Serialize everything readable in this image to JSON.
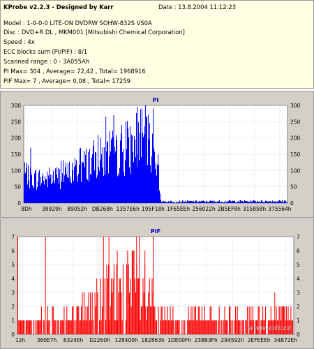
{
  "header": {
    "title": "KProbe v2.2.3 - Designed by Karr",
    "date_label": "Date : 13.8.2004 11:12:23",
    "lines": [
      "Model : 1-0-0-0 LITE-ON DVDRW SOHW-832S  VS0A",
      "Disc : DVD+R DL , MKM001 [Mitsubishi Chemical Corporation]",
      "Speed : 4x",
      "ECC blocks sum (PI/PIF) : 8/1",
      "Scanned range : 0 - 3A055Ah",
      "PI Max= 304 , Average= 72,42 , Total= 1968916",
      "PIF Max= 7 , Average= 0,08 , Total= 17259"
    ]
  },
  "watermark": "www.cdr.cz",
  "colors": {
    "pi": "#0000ff",
    "pif": "#ff0000",
    "plot_bg": "#ffffff",
    "panel_bg": "#d4d0c8",
    "info_bg": "#ffffe3",
    "title_color": "#0000b0"
  },
  "chart_data": [
    {
      "type": "bar",
      "title": "PI",
      "yticks": [
        0,
        50,
        100,
        150,
        200,
        250,
        300
      ],
      "ylim": [
        0,
        300
      ],
      "xticks": [
        "8Dh",
        "38929h",
        "89052h",
        "DB268h",
        "1357E6h",
        "195F18h",
        "1F65EEh",
        "256022h",
        "2B5EF8h",
        "315858h",
        "375564h"
      ],
      "grid": true,
      "envelope_x": [
        0,
        0.05,
        0.1,
        0.15,
        0.2,
        0.25,
        0.3,
        0.35,
        0.4,
        0.45,
        0.5,
        0.52,
        1.0
      ],
      "envelope_y": [
        120,
        110,
        115,
        125,
        150,
        190,
        205,
        215,
        245,
        280,
        230,
        8,
        10
      ],
      "spikes_x": [
        0.025,
        0.31,
        0.34,
        0.37,
        0.43,
        0.46,
        0.49
      ],
      "spikes_y": [
        170,
        265,
        270,
        240,
        295,
        300,
        290
      ]
    },
    {
      "type": "bar",
      "title": "PIF",
      "yticks": [
        0,
        1,
        2,
        3,
        4,
        5,
        6,
        7
      ],
      "ylim": [
        0,
        7
      ],
      "xticks": [
        "12h",
        "360E7h",
        "8324Eh",
        "D2260h",
        "128400h",
        "182863h",
        "1DE00Fh",
        "238B3Fh",
        "294592h",
        "2EFEEEh",
        "34B72Eh"
      ],
      "grid": true,
      "profile_x": [
        0,
        0.1,
        0.2,
        0.25,
        0.3,
        0.35,
        0.4,
        0.45,
        0.48,
        0.5,
        0.55,
        0.6,
        1.0
      ],
      "profile_y": [
        1,
        2,
        2,
        3,
        4,
        5,
        6,
        5,
        4,
        2,
        2,
        2,
        2
      ],
      "spikes_x": [
        0.0,
        0.1,
        0.31,
        0.33,
        0.36,
        0.43,
        0.44,
        0.46,
        0.49,
        0.93
      ],
      "spikes_y": [
        7,
        7,
        7,
        7,
        6,
        7,
        7,
        6,
        7,
        3
      ]
    }
  ]
}
